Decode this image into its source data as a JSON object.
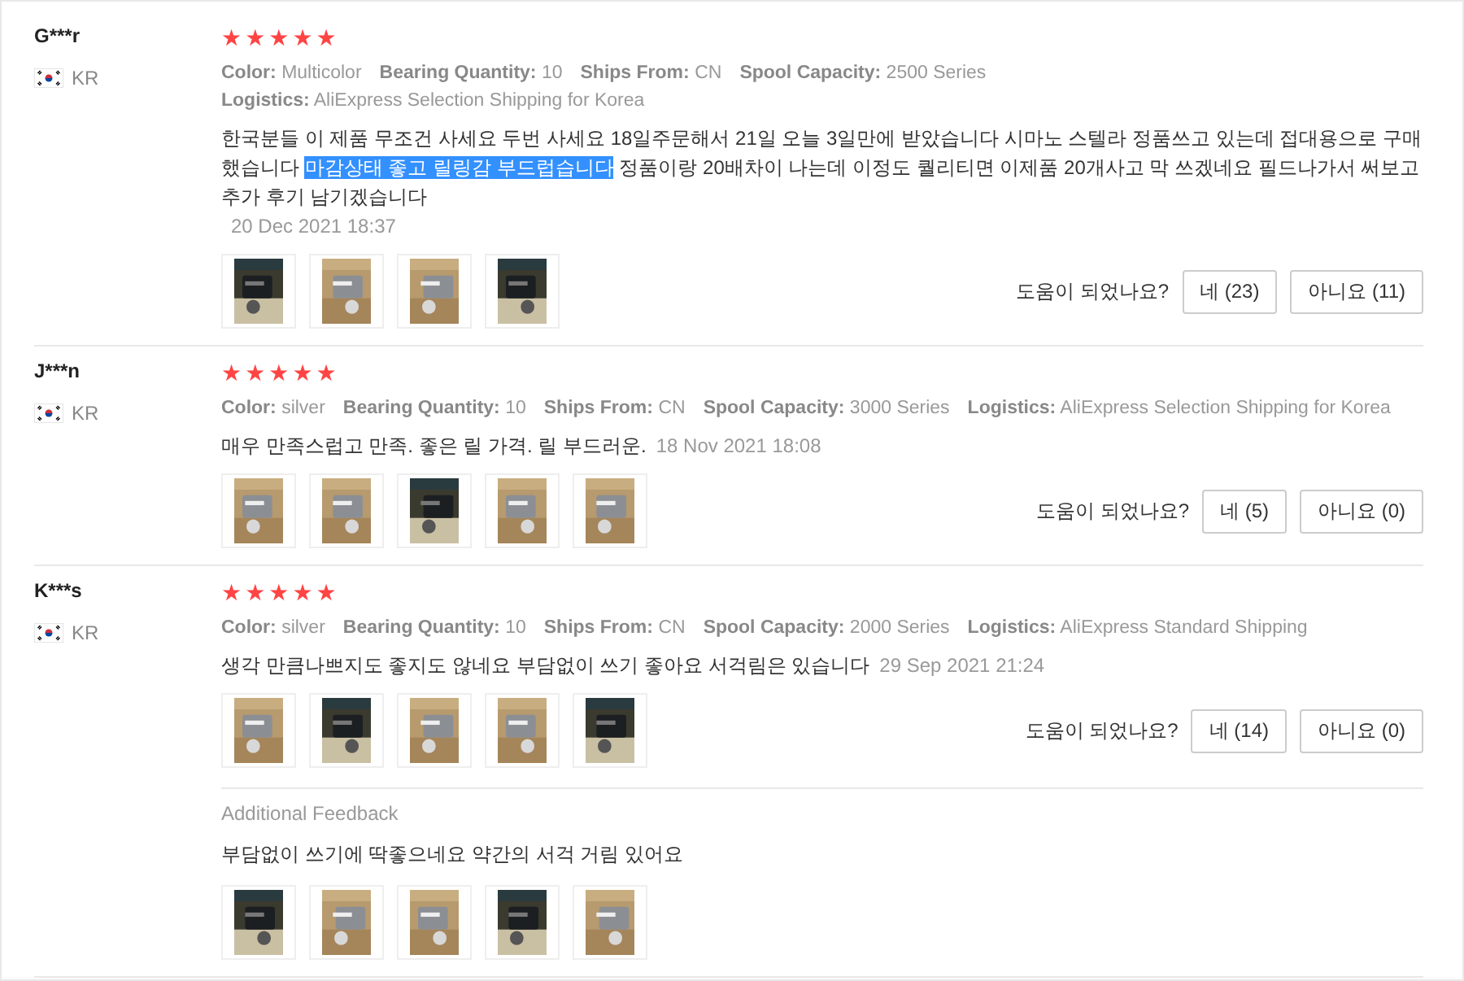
{
  "reviews": [
    {
      "user": "G***r",
      "country": "KR",
      "stars": 5,
      "attributes": [
        {
          "label": "Color:",
          "value": "Multicolor"
        },
        {
          "label": "Bearing Quantity:",
          "value": "10"
        },
        {
          "label": "Ships From:",
          "value": "CN"
        },
        {
          "label": "Spool Capacity:",
          "value": "2500 Series"
        },
        {
          "label": "Logistics:",
          "value": "AliExpress Selection Shipping for Korea"
        }
      ],
      "text_parts": [
        {
          "text": "한국분들 이 제품 무조건 사세요 두번 사세요 18일주문해서 21일 오늘 3일만에 받았습니다 시마노 스텔라 정품쓰고 있는데 접대용으로 구매했습니다 ",
          "highlighted": false
        },
        {
          "text": "마감상태 좋고 릴링감 부드럽습니다",
          "highlighted": true
        },
        {
          "text": " 정품이랑 20배차이 나는데 이정도 퀄리티면 이제품 20개사고 막 쓰겠네요 필드나가서 써보고 추가 후기 남기겠습니다",
          "highlighted": false
        }
      ],
      "date": "20 Dec 2021 18:37",
      "photos": [
        {
          "kind": "picture"
        },
        {
          "kind": "picture"
        },
        {
          "kind": "picture"
        },
        {
          "kind": "picture"
        }
      ],
      "helpful": {
        "question": "도움이 되었나요?",
        "yes": "네 (23)",
        "no": "아니요 (11)"
      }
    },
    {
      "user": "J***n",
      "country": "KR",
      "stars": 5,
      "attributes": [
        {
          "label": "Color:",
          "value": "silver"
        },
        {
          "label": "Bearing Quantity:",
          "value": "10"
        },
        {
          "label": "Ships From:",
          "value": "CN"
        },
        {
          "label": "Spool Capacity:",
          "value": "3000 Series"
        },
        {
          "label": "Logistics:",
          "value": "AliExpress Selection Shipping for Korea"
        }
      ],
      "text_parts": [
        {
          "text": "매우 만족스럽고 만족. 좋은 릴 가격. 릴 부드러운.",
          "highlighted": false
        }
      ],
      "date": "18 Nov 2021 18:08",
      "photos": [
        {
          "kind": "picture"
        },
        {
          "kind": "picture"
        },
        {
          "kind": "picture"
        },
        {
          "kind": "picture"
        },
        {
          "kind": "picture"
        }
      ],
      "helpful": {
        "question": "도움이 되었나요?",
        "yes": "네 (5)",
        "no": "아니요 (0)"
      }
    },
    {
      "user": "K***s",
      "country": "KR",
      "stars": 5,
      "attributes": [
        {
          "label": "Color:",
          "value": "silver"
        },
        {
          "label": "Bearing Quantity:",
          "value": "10"
        },
        {
          "label": "Ships From:",
          "value": "CN"
        },
        {
          "label": "Spool Capacity:",
          "value": "2000 Series"
        },
        {
          "label": "Logistics:",
          "value": "AliExpress Standard Shipping"
        }
      ],
      "text_parts": [
        {
          "text": "생각 만큼나쁘지도 좋지도 않네요 부담없이 쓰기 좋아요 서걱림은 있습니다",
          "highlighted": false
        }
      ],
      "date": "29 Sep 2021 21:24",
      "photos": [
        {
          "kind": "picture"
        },
        {
          "kind": "picture"
        },
        {
          "kind": "picture"
        },
        {
          "kind": "picture"
        },
        {
          "kind": "picture"
        }
      ],
      "helpful": {
        "question": "도움이 되었나요?",
        "yes": "네 (14)",
        "no": "아니요 (0)"
      },
      "additional": {
        "title": "Additional Feedback",
        "text": "부담없이 쓰기에 딱좋으네요 약간의 서걱 거림 있어요",
        "photos": [
          {
            "kind": "picture"
          },
          {
            "kind": "picture"
          },
          {
            "kind": "picture"
          },
          {
            "kind": "picture"
          },
          {
            "kind": "picture"
          }
        ]
      }
    }
  ]
}
